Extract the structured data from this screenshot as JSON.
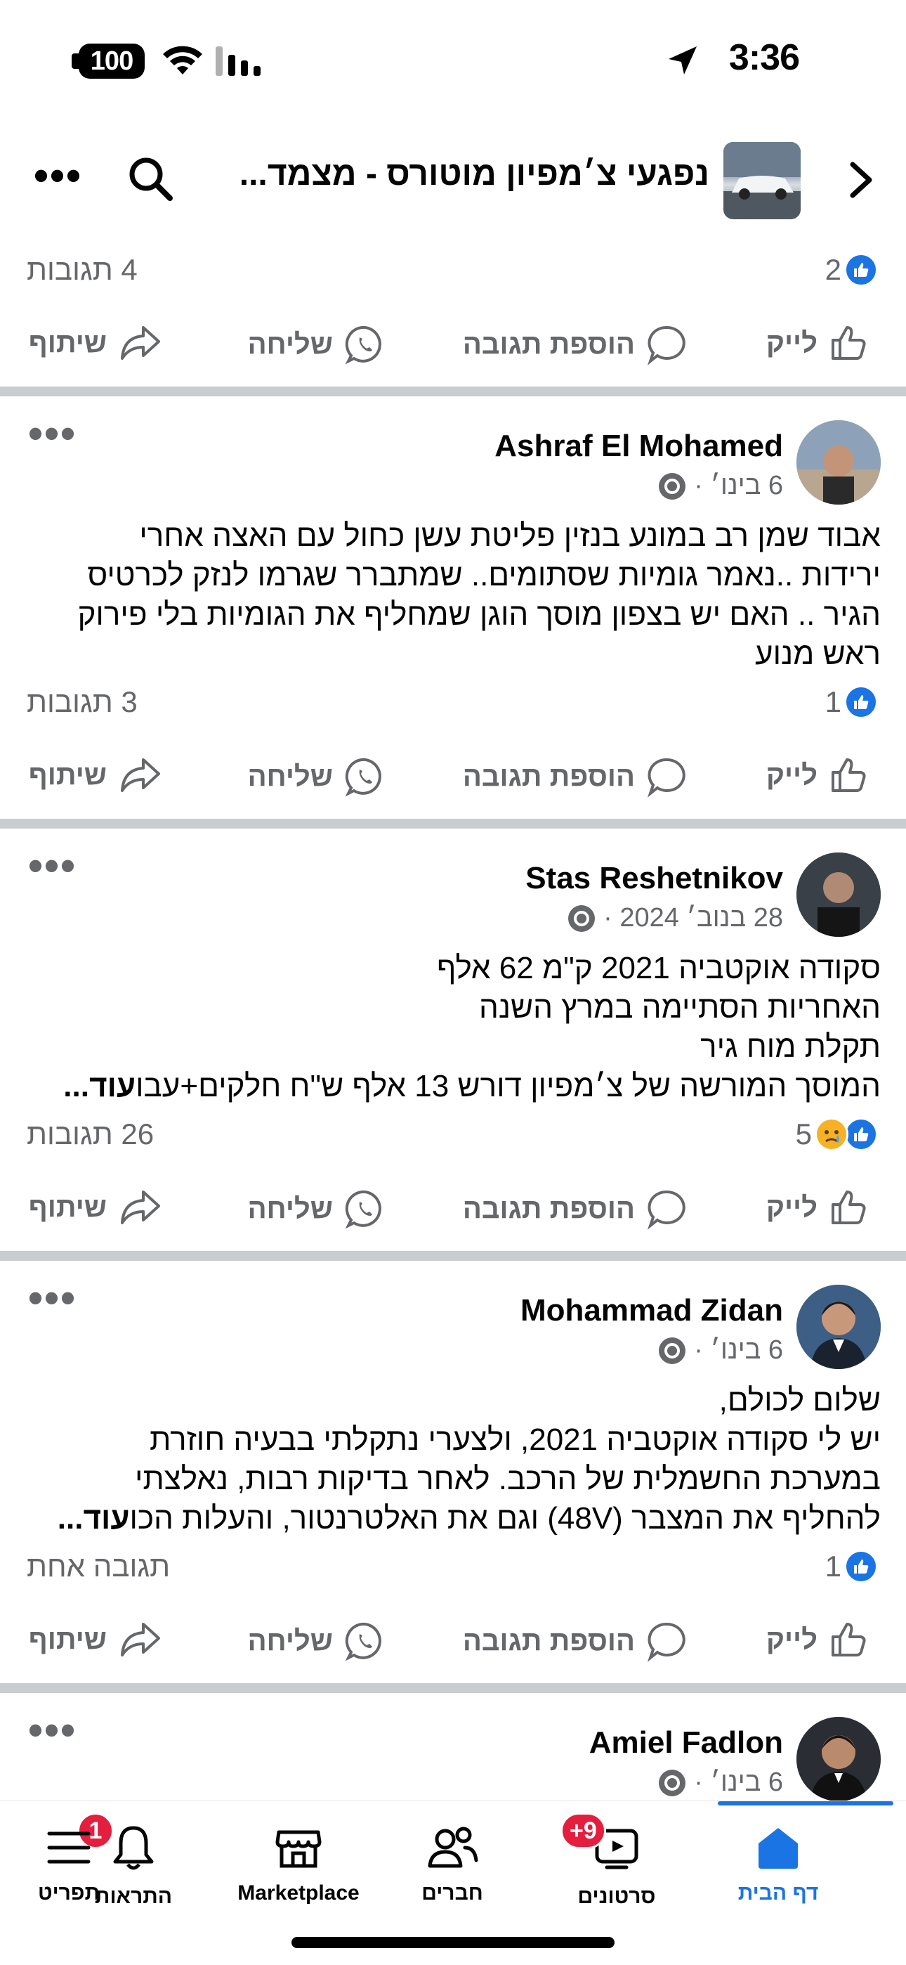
{
  "status_bar": {
    "battery": "100",
    "time": "3:36"
  },
  "header": {
    "title": "נפגעי צ׳מפיון מוטורס - מצמד..."
  },
  "top_post": {
    "likes": "2",
    "comments": "4 תגובות"
  },
  "actions": {
    "like": "לייק",
    "comment": "הוספת תגובה",
    "send": "שליחה",
    "share": "שיתוף"
  },
  "posts": [
    {
      "author": "Ashraf El Mohamed",
      "date": "6 בינו׳ ·",
      "body_lines": [
        "אבוד שמן רב במונע בנזין פליטת עשן כחול עם האצה אחרי",
        "ירידות ..נאמר גומיות שסתומים.. שמתברר  שגרמו לנזק לכרטיס",
        "הגיר .. האם יש בצפון מוסך הוגן שמחליף את הגומיות בלי פירוק",
        "ראש מנוע"
      ],
      "more": "",
      "likes": "1",
      "comments": "3 תגובות"
    },
    {
      "author": "Stas Reshetnikov",
      "date": "28 בנוב׳ 2024 ·",
      "body_lines": [
        "סקודה אוקטביה 2021 ק\"מ 62 אלף",
        "האחריות הסתיימה במרץ השנה",
        "תקלת מוח גיר",
        "המוסך המורשה של צ׳מפיון דורש 13 אלף ש\"ח חלקים+עבו"
      ],
      "more": "עוד...",
      "likes": "5",
      "comments": "26 תגובות"
    },
    {
      "author": "Mohammad Zidan",
      "date": "6 בינו׳ ·",
      "body_lines": [
        "שלום לכולם,",
        "יש לי סקודה אוקטביה 2021, ולצערי נתקלתי בבעיה חוזרת",
        "במערכת החשמלית של הרכב. לאחר בדיקות רבות, נאלצתי",
        "להחליף את המצבר (48V) וגם את האלטרנטור, והעלות הכו"
      ],
      "more": "עוד...",
      "likes": "1",
      "comments": "תגובה אחת"
    },
    {
      "author": "Amiel Fadlon",
      "date": "6 בינו׳ ·"
    }
  ],
  "tabbar": {
    "home": "דף הבית",
    "videos": "סרטונים",
    "videos_badge": "+9",
    "friends": "חברים",
    "marketplace": "Marketplace",
    "notifications": "התראות",
    "notifications_badge": "1",
    "menu": "תפריט"
  },
  "colors": {
    "accent": "#1b74e4",
    "badge": "#e41e3f",
    "muted": "#65676b",
    "separator": "#c9ccd1"
  }
}
